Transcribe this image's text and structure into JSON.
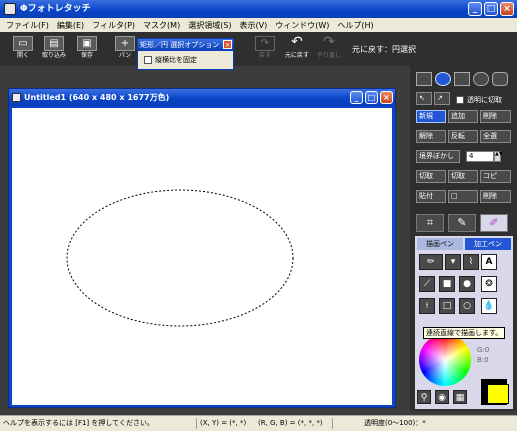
{
  "window": {
    "title": "Φフォトレタッチ"
  },
  "menu": [
    "ファイル(F)",
    "編集(E)",
    "フィルタ(P)",
    "マスク(M)",
    "選択領域(S)",
    "表示(V)",
    "ウィンドウ(W)",
    "ヘルプ(H)"
  ],
  "toolbar": {
    "open": "開く",
    "import": "取り込み",
    "save": "保存",
    "new_partial": "パン",
    "redo_dim": "戻す",
    "undo": "元に戻す",
    "repeat_dim": "やり直し",
    "undo_status": "元に戻す：円選択"
  },
  "option_panel": {
    "title": "矩形／円 選択オプション",
    "checkbox_label": "縦横比を固定",
    "checked": false
  },
  "document": {
    "title": "Untitled1 (640 x 480 x 1677万色)"
  },
  "palette": {
    "antialias_label": "透明に切取",
    "new": "新規",
    "add": "追加",
    "subtract": "削除",
    "invert": "解除",
    "flip": "反転",
    "all": "全選",
    "feather_label": "境界ぼかし",
    "feather_value": "4",
    "cut": "切取",
    "copy": "切取",
    "copy2": "コピ",
    "paste": "貼付",
    "delete": "削除",
    "sub_tab_pen": "描画ペン",
    "sub_tab_edit": "加工ペン",
    "text_tool": "A",
    "tooltip": "連続直線で描画します。",
    "rgb_g": "G:0",
    "rgb_b": "B:0",
    "fg_color": "#ffff00",
    "bg_color": "#000000"
  },
  "status": {
    "help": "ヘルプを表示するには [F1] を押してください。",
    "coords": "(X, Y) = (*, *)",
    "rgb": "(R, G, B) = (*, *, *)",
    "opacity": "透明度(0〜100)：*"
  }
}
